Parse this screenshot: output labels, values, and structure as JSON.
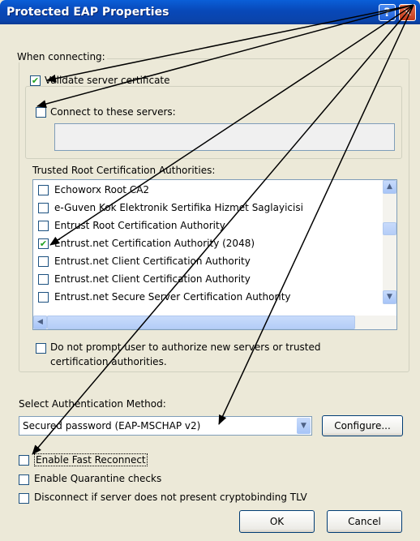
{
  "window": {
    "title": "Protected EAP Properties",
    "help_icon": "?",
    "close_icon": "✕"
  },
  "connecting": {
    "label": "When connecting:",
    "validate_cert": {
      "label": "Validate server certificate",
      "checked": true
    },
    "connect_servers": {
      "label": "Connect to these servers:",
      "checked": false,
      "value": ""
    },
    "trusted_label": "Trusted Root Certification Authorities:",
    "cert_list": [
      {
        "label": "Echoworx Root CA2",
        "checked": false
      },
      {
        "label": "e-Guven Kok Elektronik Sertifika Hizmet Saglayicisi",
        "checked": false
      },
      {
        "label": "Entrust Root Certification Authority",
        "checked": false
      },
      {
        "label": "Entrust.net Certification Authority (2048)",
        "checked": true
      },
      {
        "label": "Entrust.net Client Certification Authority",
        "checked": false
      },
      {
        "label": "Entrust.net Client Certification Authority",
        "checked": false
      },
      {
        "label": "Entrust.net Secure Server Certification Authority",
        "checked": false
      }
    ],
    "do_not_prompt": {
      "line1": "Do not prompt user to authorize new servers or trusted",
      "line2": "certification authorities.",
      "checked": false
    }
  },
  "auth": {
    "label": "Select Authentication Method:",
    "method": "Secured password (EAP-MSCHAP v2)",
    "configure_label": "Configure..."
  },
  "options": {
    "fast_reconnect": {
      "label": "Enable Fast Reconnect",
      "checked": false
    },
    "quarantine": {
      "label": "Enable Quarantine checks",
      "checked": false
    },
    "cryptobinding": {
      "label": "Disconnect if server does not present cryptobinding TLV",
      "checked": false
    }
  },
  "buttons": {
    "ok": "OK",
    "cancel": "Cancel"
  },
  "check_glyph": "✔"
}
